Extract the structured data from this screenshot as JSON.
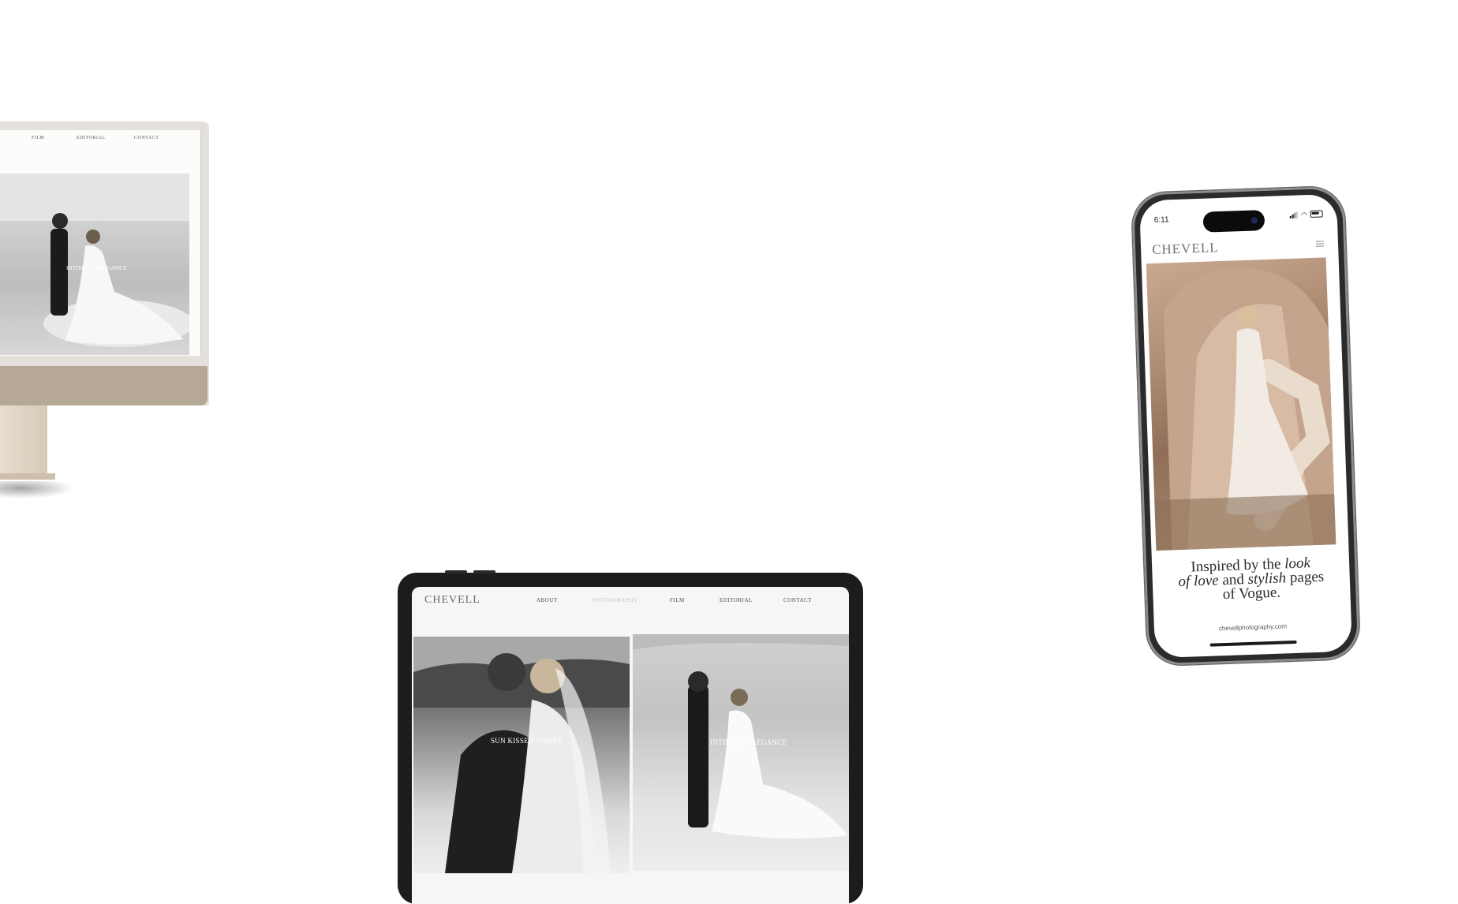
{
  "imac": {
    "nav": {
      "film": "FILM",
      "editorial": "EDITORIAL",
      "contact": "CONTACT"
    },
    "photo_caption": "INTIMATE ELEGANCE"
  },
  "ipad": {
    "logo": "CHEVELL",
    "nav": {
      "about": "ABOUT",
      "photography": "PHOTOGRAPHY",
      "film": "FILM",
      "editorial": "EDITORIAL",
      "contact": "CONTACT"
    },
    "left_caption": "SUN KISSED SOIRÉE",
    "right_caption": "INTIMATE ELEGANCE"
  },
  "iphone": {
    "time": "6:11",
    "logo": "CHEVELL",
    "quote": {
      "part1": "Inspired by the ",
      "em1": "look",
      "em2": "of love",
      "part2": " and ",
      "em3": "stylish",
      "part3": " pages",
      "part4": "of Vogue."
    },
    "url": "chevellphotography.com"
  },
  "colors": {
    "imac_chin": "#b5a996",
    "imac_stand": "#e6ddd0",
    "ipad_frame": "#1c1c1c",
    "iphone_frame": "#2b2b2b",
    "nav_dim": "#c5c5c5"
  }
}
